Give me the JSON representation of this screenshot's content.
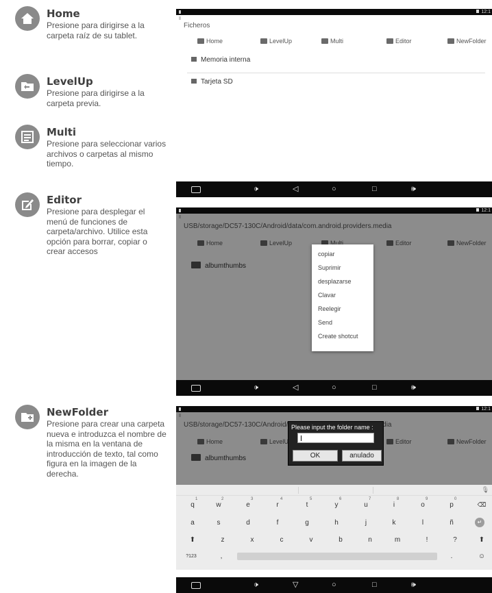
{
  "items": [
    {
      "icon": "home-icon",
      "title": "Home",
      "desc": "Presione para dirigirse a la carpeta raíz de su tablet."
    },
    {
      "icon": "level-up-icon",
      "title": "LevelUp",
      "desc": "Presione para dirigirse a la carpeta previa."
    },
    {
      "icon": "multi-icon",
      "title": "Multi",
      "desc": "Presione para seleccionar varios archivos o carpetas al mismo tiempo."
    },
    {
      "icon": "editor-icon",
      "title": "Editor",
      "desc": "Presione para desplegar el menú de funciones de carpeta/archivo. Utilice esta opción para borrar, copiar o crear accesos"
    },
    {
      "icon": "new-folder-icon",
      "title": "NewFolder",
      "desc": "Presione para crear una carpeta nueva e introduzca el nombre de la misma en la ventana de introducción de texto, tal como figura en la imagen de la derecha."
    }
  ],
  "status_time": "12:1",
  "tabs": [
    "Home",
    "LevelUp",
    "Multi",
    "Editor",
    "NewFolder"
  ],
  "screen1": {
    "path": "Ficheros",
    "entries": [
      "Memoria interna",
      "Tarjeta SD"
    ]
  },
  "screen2": {
    "path": "USB/storage/DC57-130C/Android/data/com.android.providers.media",
    "folder": "albumthumbs",
    "menu": [
      "copiar",
      "Suprimir",
      "desplazarse",
      "Clavar",
      "Reelegir",
      "Send",
      "Create shotcut"
    ]
  },
  "screen3": {
    "path": "USB/storage/DC57-130C/Android/data/com.android.providers.media",
    "folder": "albumthumbs",
    "dialog_title": "Please input the folder name :",
    "ok": "OK",
    "cancel": "anulado",
    "keyboard": {
      "row1": [
        "q",
        "w",
        "e",
        "r",
        "t",
        "y",
        "u",
        "i",
        "o",
        "p"
      ],
      "row1_nums": [
        "1",
        "2",
        "3",
        "4",
        "5",
        "6",
        "7",
        "8",
        "9",
        "0"
      ],
      "row2": [
        "a",
        "s",
        "d",
        "f",
        "g",
        "h",
        "j",
        "k",
        "l",
        "ñ"
      ],
      "row3": [
        "z",
        "x",
        "c",
        "v",
        "b",
        "n",
        "m",
        "!",
        "?"
      ],
      "mode_key": "?123",
      "comma": ",",
      "period": "."
    }
  },
  "nav_glyphs": {
    "back": "◁",
    "back_down": "▽",
    "home": "○",
    "recents": "□",
    "vol_down": "🕩",
    "vol_up": "🕪"
  }
}
